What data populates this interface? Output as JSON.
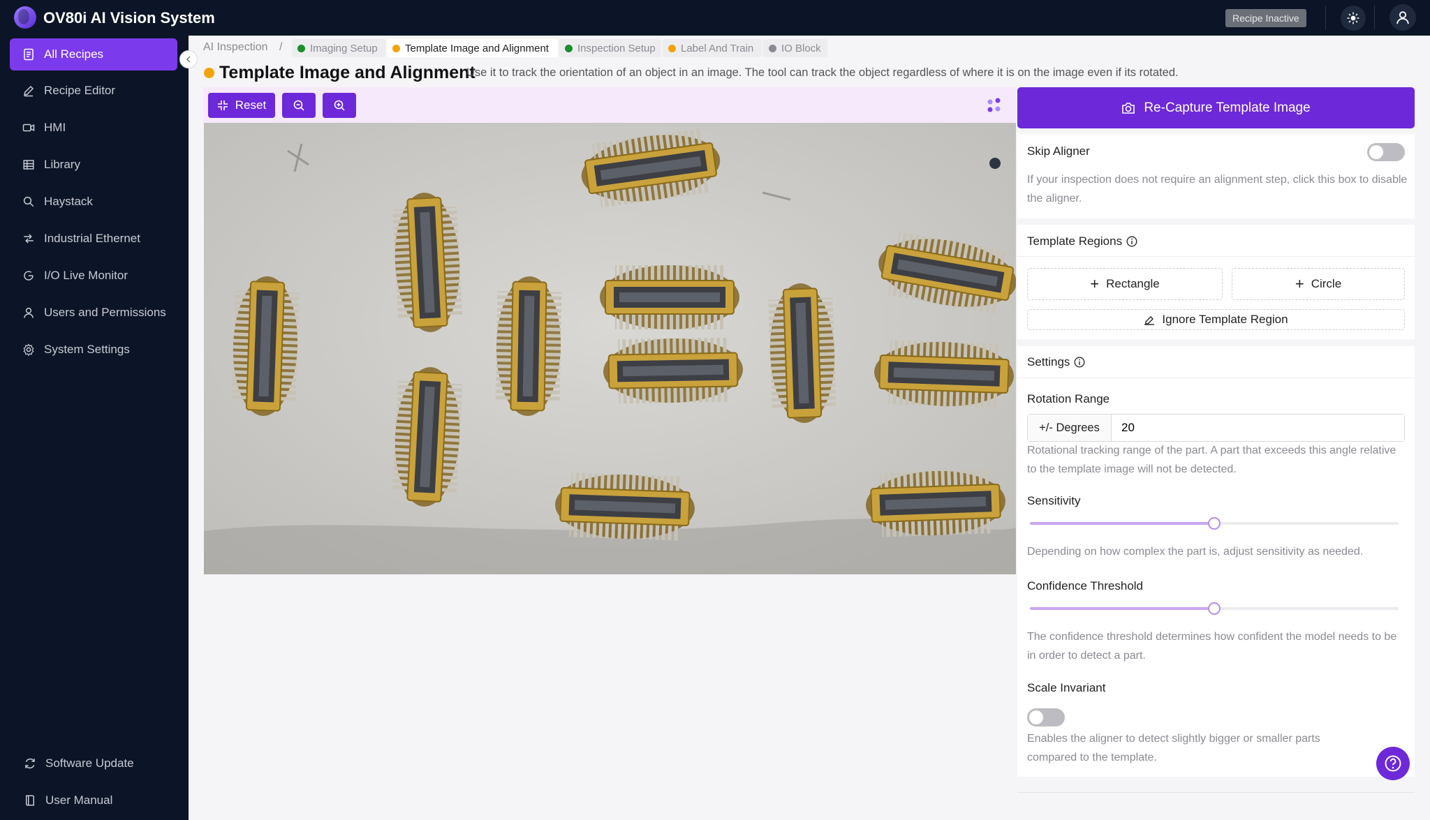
{
  "app": {
    "title": "OV80i AI Vision System",
    "status": "Recipe Inactive"
  },
  "sidebar": {
    "items": [
      {
        "label": "All Recipes",
        "icon": "document-icon",
        "active": true
      },
      {
        "label": "Recipe Editor",
        "icon": "pencil-icon"
      },
      {
        "label": "HMI",
        "icon": "video-icon"
      },
      {
        "label": "Library",
        "icon": "grid-icon"
      },
      {
        "label": "Haystack",
        "icon": "search-icon"
      },
      {
        "label": "Industrial Ethernet",
        "icon": "network-icon"
      },
      {
        "label": "I/O Live Monitor",
        "icon": "monitor-icon"
      },
      {
        "label": "Users and Permissions",
        "icon": "user-icon"
      },
      {
        "label": "System Settings",
        "icon": "gear-icon"
      }
    ],
    "bottom": [
      {
        "label": "Software Update",
        "icon": "refresh-icon"
      },
      {
        "label": "User Manual",
        "icon": "book-icon"
      }
    ]
  },
  "breadcrumb": {
    "root": "AI Inspection",
    "separator": "/",
    "steps": [
      {
        "label": "Imaging Setup",
        "color": "#1a8f2a"
      },
      {
        "label": "Template Image and Alignment",
        "color": "#f5a20a",
        "current": true
      },
      {
        "label": "Inspection Setup",
        "color": "#1a8f2a"
      },
      {
        "label": "Label And Train",
        "color": "#f5a20a"
      },
      {
        "label": "IO Block",
        "color": "#8a8a92"
      }
    ]
  },
  "page": {
    "title": "Template Image and Alignment",
    "description": "Use it to track the orientation of an object in an image. The tool can track the object regardless of where it is on the image even if its rotated."
  },
  "toolbar": {
    "reset_label": "Reset"
  },
  "panel": {
    "recapture_label": "Re-Capture Template Image",
    "skip_aligner": {
      "title": "Skip Aligner",
      "enabled": false,
      "help": "If your inspection does not require an alignment step, click this box to disable the aligner."
    },
    "template_regions": {
      "title": "Template Regions",
      "rectangle_label": "Rectangle",
      "circle_label": "Circle",
      "ignore_label": "Ignore Template Region"
    },
    "settings": {
      "title": "Settings",
      "rotation_range": {
        "label": "Rotation Range",
        "unit": "+/- Degrees",
        "value": "20",
        "help": "Rotational tracking range of the part. A part that exceeds this angle relative to the template image will not be detected."
      },
      "sensitivity": {
        "label": "Sensitivity",
        "level": 0.5,
        "help": "Depending on how complex the part is, adjust sensitivity as needed."
      },
      "confidence": {
        "label": "Confidence Threshold",
        "level": 0.5,
        "help": "The confidence threshold determines how confident the model needs to be in order to detect a part."
      },
      "scale_invariant": {
        "label": "Scale Invariant",
        "enabled": false,
        "help": "Enables the aligner to detect slightly bigger or smaller parts compared to the template."
      }
    }
  },
  "colors": {
    "accent": "#6d28d9",
    "sidebar_bg": "#0c1527",
    "toolbar_bg": "#f6e9fb"
  }
}
